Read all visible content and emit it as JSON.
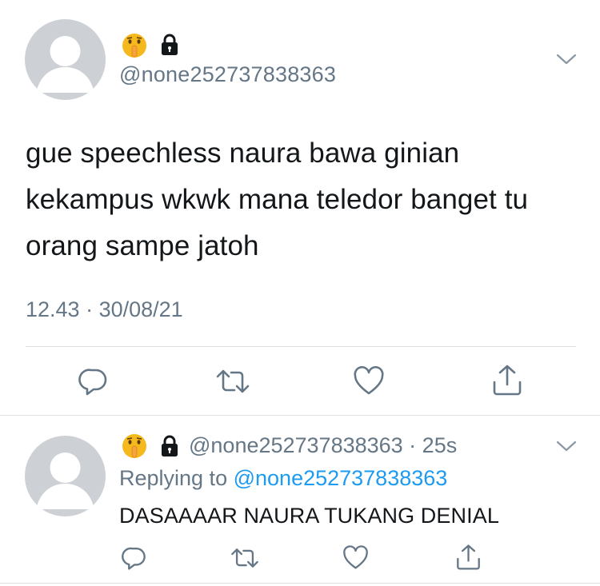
{
  "tweet": {
    "handle": "@none252737838363",
    "text": "gue speechless naura bawa ginian kekampus wkwk mana teledor banget tu orang sampe jatoh",
    "time": "12.43",
    "separator": " · ",
    "date": "30/08/21",
    "badge_icons": [
      "shushing-face-emoji",
      "lock-icon"
    ]
  },
  "actions": [
    "reply-icon",
    "retweet-icon",
    "like-icon",
    "share-icon"
  ],
  "reply": {
    "handle": "@none252737838363",
    "separator": " · ",
    "age": "25s",
    "replying_to_label": "Replying to",
    "replying_to_handle": "@none252737838363",
    "text": "DASAAAAR NAURA TUKANG DENIAL"
  },
  "colors": {
    "text": "#14171a",
    "secondary": "#657786",
    "link": "#1d9bf0",
    "divider": "#dfe3e6",
    "avatar": "#cdd1d5"
  }
}
